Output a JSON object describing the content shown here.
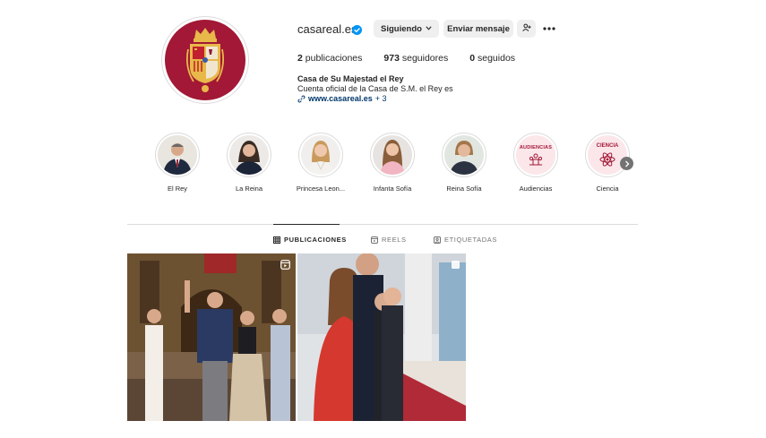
{
  "profile": {
    "username": "casareal.es",
    "follow_button": "Siguiendo",
    "message_button": "Enviar mensaje",
    "stats": {
      "posts_count": "2",
      "posts_label": "publicaciones",
      "followers_count": "973",
      "followers_label": "seguidores",
      "following_count": "0",
      "following_label": "seguidos"
    },
    "bio": {
      "name": "Casa de Su Majestad el Rey",
      "description": "Cuenta oficial de la Casa de S.M. el Rey es",
      "link": "www.casareal.es",
      "more_links": "+ 3"
    }
  },
  "highlights": [
    {
      "label": "El Rey",
      "icon": "portrait"
    },
    {
      "label": "La Reina",
      "icon": "portrait"
    },
    {
      "label": "Princesa Leon...",
      "icon": "portrait"
    },
    {
      "label": "Infanta Sofía",
      "icon": "portrait"
    },
    {
      "label": "Reina Sofía",
      "icon": "portrait"
    },
    {
      "label": "Audiencias",
      "cover_text": "AUDIENCIAS",
      "icon": "audience-icon"
    },
    {
      "label": "Ciencia",
      "cover_text": "CIENCIA",
      "icon": "atom-icon"
    }
  ],
  "tabs": {
    "posts": "PUBLICACIONES",
    "reels": "REELS",
    "tagged": "ETIQUETADAS"
  },
  "colors": {
    "brand": "#a21836",
    "verified": "#0095f6",
    "link": "#00376b"
  }
}
